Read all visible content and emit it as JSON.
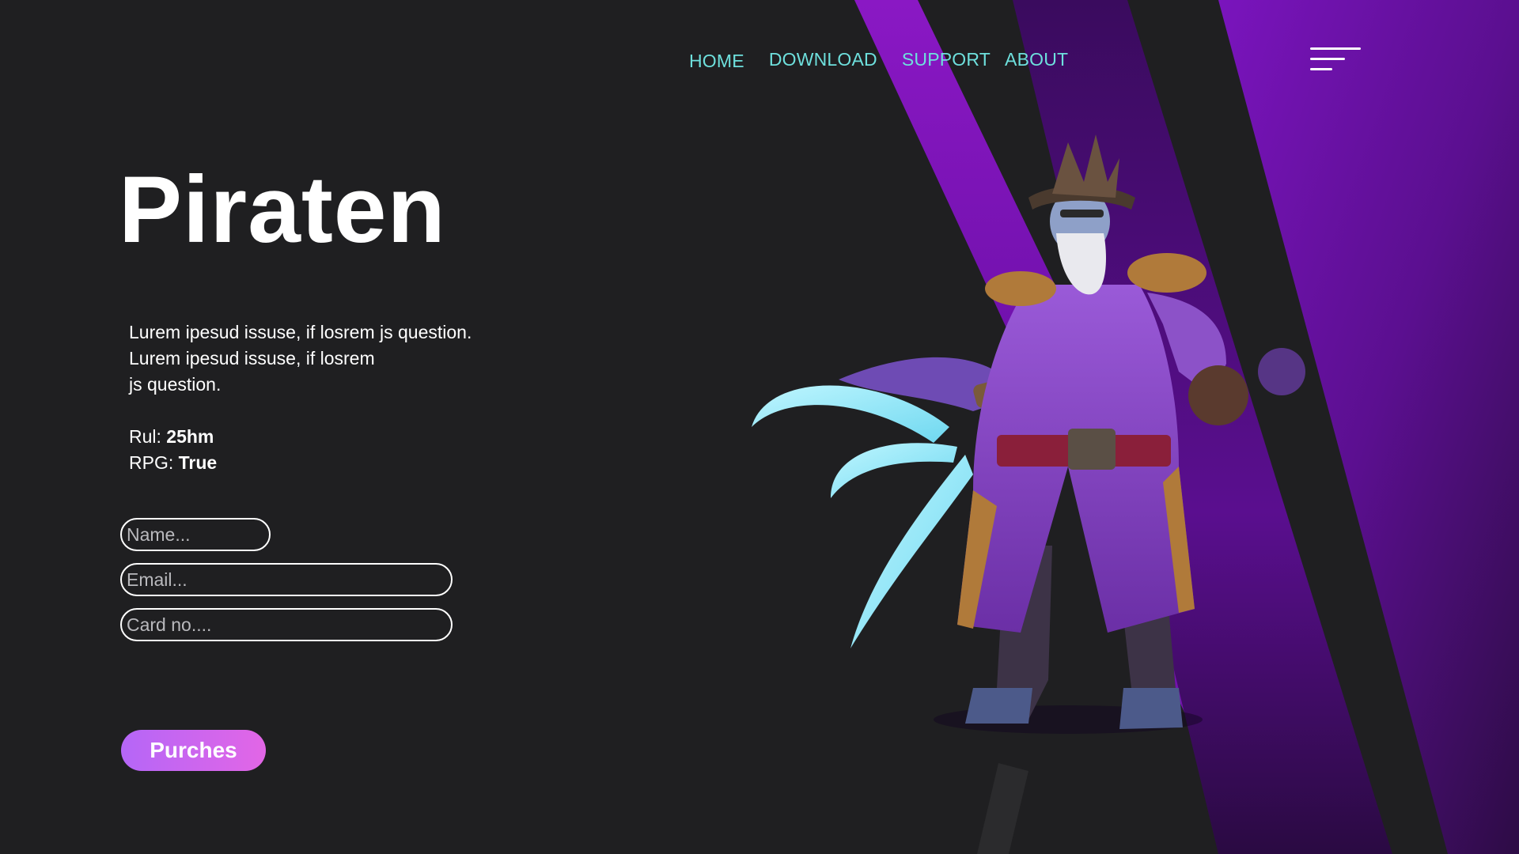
{
  "nav": {
    "home": "HOME",
    "download": "DOWNLOAD",
    "support": "SUPPORT",
    "about": "ABOUT"
  },
  "hero": {
    "title": "Piraten",
    "description_lines": [
      "Lurem ipesud issuse, if losrem js question.",
      "Lurem ipesud issuse, if losrem",
      "js question."
    ],
    "meta": [
      {
        "label": "Rul: ",
        "value": "25hm"
      },
      {
        "label": "RPG: ",
        "value": "True"
      }
    ]
  },
  "form": {
    "name_placeholder": "Name...",
    "email_placeholder": "Email...",
    "card_placeholder": "Card no....",
    "submit_label": "Purches"
  },
  "colors": {
    "background": "#1f1f21",
    "nav_text": "#6ee0dd",
    "stripe_purple": "#7a14b8",
    "button_gradient_start": "#b566f7",
    "button_gradient_end": "#e266e6"
  },
  "icons": {
    "menu": "hamburger-menu-icon"
  }
}
